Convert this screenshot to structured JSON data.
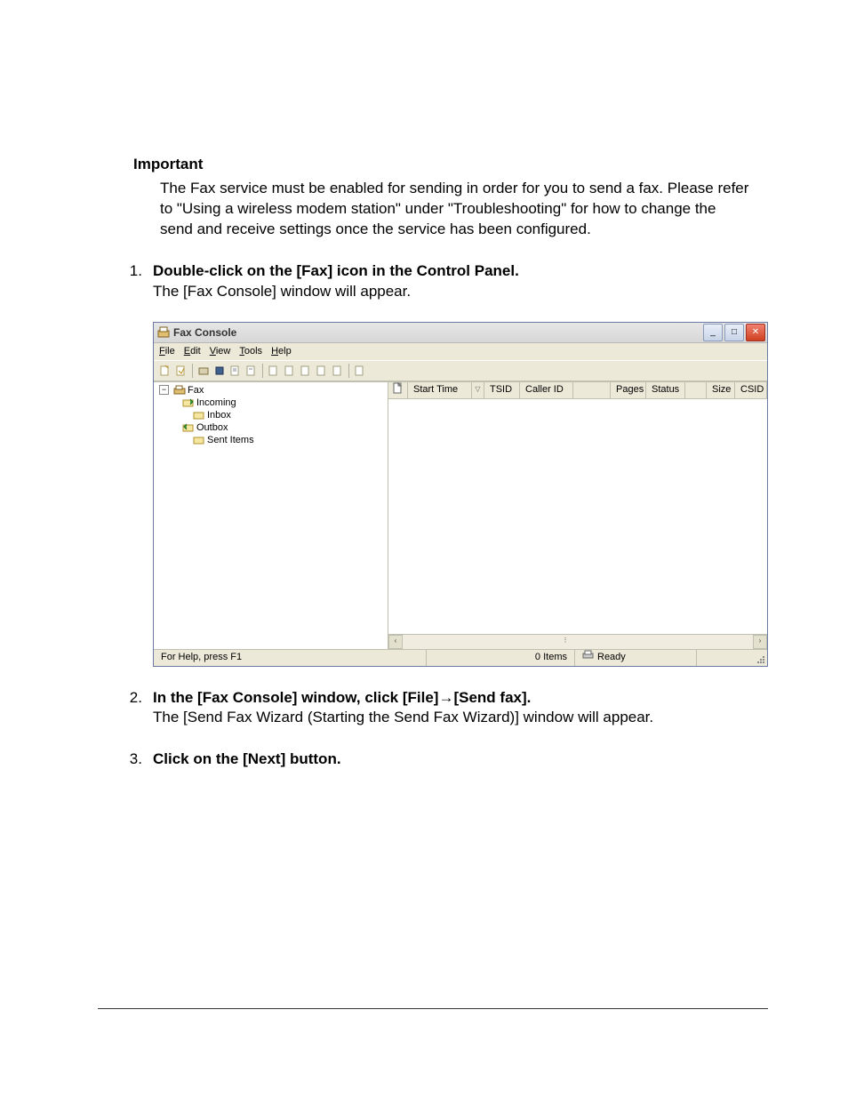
{
  "important": {
    "heading": "Important",
    "body": "The Fax service must be enabled for sending in order for you to send a fax. Please refer to \"Using a wireless modem station\" under \"Troubleshooting\" for how to change the send and receive settings once the service has been configured."
  },
  "steps": [
    {
      "bold": "Double-click on the [Fax] icon in the Control Panel.",
      "body": "The [Fax Console] window will appear."
    },
    {
      "bold": "In the [Fax Console] window, click [File]→[Send fax].",
      "body": "The [Send Fax Wizard (Starting the Send Fax Wizard)] window will appear."
    },
    {
      "bold": "Click on the [Next] button.",
      "body": ""
    }
  ],
  "fax_console": {
    "title": "Fax Console",
    "menus": {
      "file": "File",
      "edit": "Edit",
      "view": "View",
      "tools": "Tools",
      "help": "Help"
    },
    "tree": {
      "root": "Fax",
      "incoming": "Incoming",
      "inbox": "Inbox",
      "outbox": "Outbox",
      "sent": "Sent Items"
    },
    "columns": {
      "start_time": "Start Time",
      "tsid": "TSID",
      "caller_id": "Caller ID",
      "pages": "Pages",
      "status": "Status",
      "size": "Size",
      "csid": "CSID"
    },
    "statusbar": {
      "help": "For Help, press F1",
      "items": "0 Items",
      "ready": "Ready"
    },
    "expander_minus": "−",
    "win_buttons": {
      "min": "_",
      "max": "□",
      "close": "✕"
    },
    "scroll": {
      "left": "‹",
      "right": "›",
      "thumb_mark": "⠇"
    }
  }
}
